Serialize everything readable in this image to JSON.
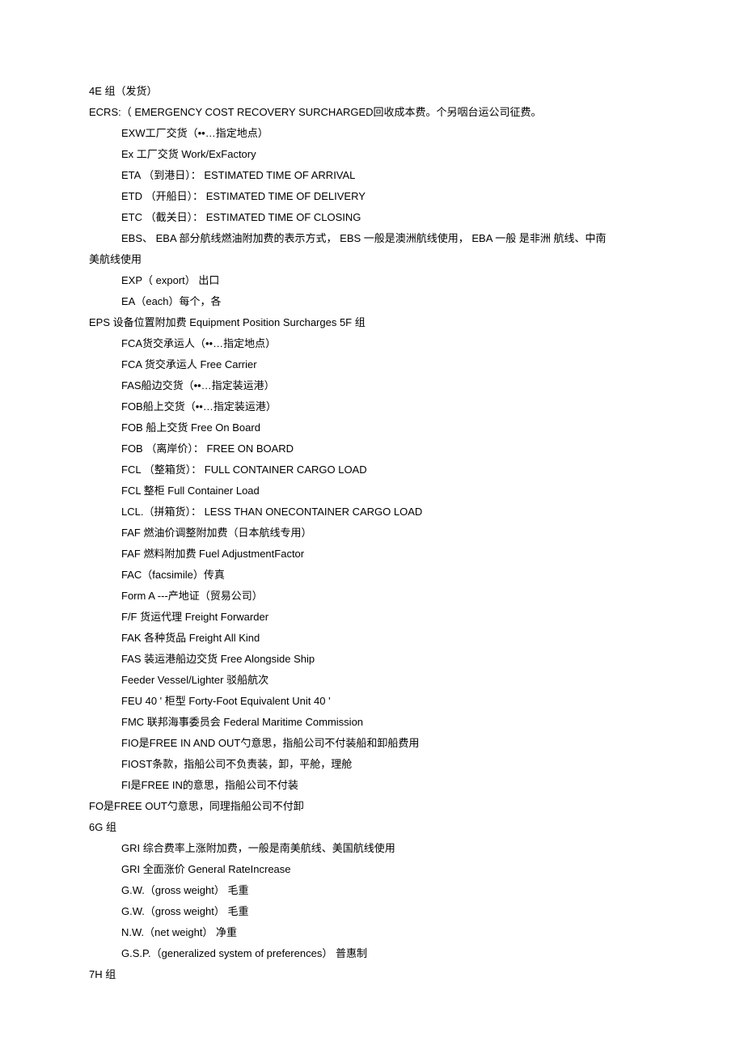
{
  "lines": [
    {
      "indent": 0,
      "text": "4E 组（发货）"
    },
    {
      "indent": 0,
      "text": "ECRS:（ EMERGENCY COST RECOVERY SURCHARGED回收成本费。个另咽台运公司征费。"
    },
    {
      "indent": 1,
      "text": "EXW工厂交货（••…指定地点）"
    },
    {
      "indent": 1,
      "text": "Ex 工厂交货  Work/ExFactory"
    },
    {
      "indent": 1,
      "text": "ETA （到港日）：  ESTIMATED TIME OF ARRIVAL"
    },
    {
      "indent": 1,
      "text": "ETD （开船日）：  ESTIMATED TIME OF DELIVERY"
    },
    {
      "indent": 1,
      "text": "ETC （截关日）：  ESTIMATED TIME OF CLOSING"
    },
    {
      "indent": 1,
      "text": "EBS、  EBA 部分航线燃油附加费的表示方式，  EBS 一般是澳洲航线使用，  EBA 一般  是非洲  航线、中南"
    },
    {
      "indent": 0,
      "text": "美航线使用"
    },
    {
      "indent": 1,
      "text": "EXP（ export）  出口"
    },
    {
      "indent": 1,
      "text": "EA（each）每个，各"
    },
    {
      "indent": 0,
      "text": "EPS 设备位置附加费  Equipment Position Surcharges 5F 组"
    },
    {
      "indent": 1,
      "text": "FCA货交承运人（••…指定地点）"
    },
    {
      "indent": 1,
      "text": "FCA 货交承运人       Free Carrier"
    },
    {
      "indent": 1,
      "text": "FAS船边交货（••…指定装运港）"
    },
    {
      "indent": 1,
      "text": "FOB船上交货（••…指定装运港）"
    },
    {
      "indent": 1,
      "text": "FOB 船上交货  Free On Board"
    },
    {
      "indent": 1,
      "text": "FOB （离岸价）：  FREE ON BOARD"
    },
    {
      "indent": 1,
      "text": "FCL （整箱货）：  FULL CONTAINER CARGO LOAD"
    },
    {
      "indent": 1,
      "text": "FCL 整柜  Full Container Load"
    },
    {
      "indent": 1,
      "text": "LCL.（拼箱货）： LESS THAN ONECONTAINER CARGO LOAD"
    },
    {
      "indent": 1,
      "text": "FAF 燃油价调整附加费（日本航线专用）"
    },
    {
      "indent": 1,
      "text": "FAF 燃料附加费        Fuel AdjustmentFactor"
    },
    {
      "indent": 1,
      "text": "FAC（facsimile）传真"
    },
    {
      "indent": 1,
      "text": "Form A ---产地证（贸易公司）"
    },
    {
      "indent": 1,
      "text": "F/F 货运代理  Freight Forwarder"
    },
    {
      "indent": 1,
      "text": "FAK 各种货品  Freight All Kind"
    },
    {
      "indent": 1,
      "text": "FAS 装运港船边交货         Free Alongside Ship"
    },
    {
      "indent": 1,
      "text": "Feeder Vessel/Lighter 驳船航次"
    },
    {
      "indent": 1,
      "text": "FEU 40  ' 柜型  Forty-Foot Equivalent Unit 40         '"
    },
    {
      "indent": 1,
      "text": "FMC 联邦海事委员会  Federal Maritime Commission"
    },
    {
      "indent": 1,
      "text": "FIO是FREE IN AND OUT勺意思，指船公司不付装船和卸船费用"
    },
    {
      "indent": 1,
      "text": "FIOST条款，指船公司不负责装，卸，平舱，理舱"
    },
    {
      "indent": 1,
      "text": "FI是FREE IN的意思，指船公司不付装"
    },
    {
      "indent": 0,
      "text": "FO是FREE OUT勺意思，同理指船公司不付卸"
    },
    {
      "indent": 0,
      "text": "6G 组"
    },
    {
      "indent": 1,
      "text": "GRI 综合费率上涨附加费，一般是南美航线、美国航线使用"
    },
    {
      "indent": 1,
      "text": "GRI 全面涨价        General RateIncrease"
    },
    {
      "indent": 1,
      "text": "G.W.（gross weight）  毛重"
    },
    {
      "indent": 1,
      "text": "G.W.（gross weight）  毛重"
    },
    {
      "indent": 1,
      "text": "N.W.（net weight）  净重"
    },
    {
      "indent": 1,
      "text": "G.S.P.（generalized system of preferences）  普惠制"
    },
    {
      "indent": 0,
      "text": "7H 组"
    }
  ]
}
